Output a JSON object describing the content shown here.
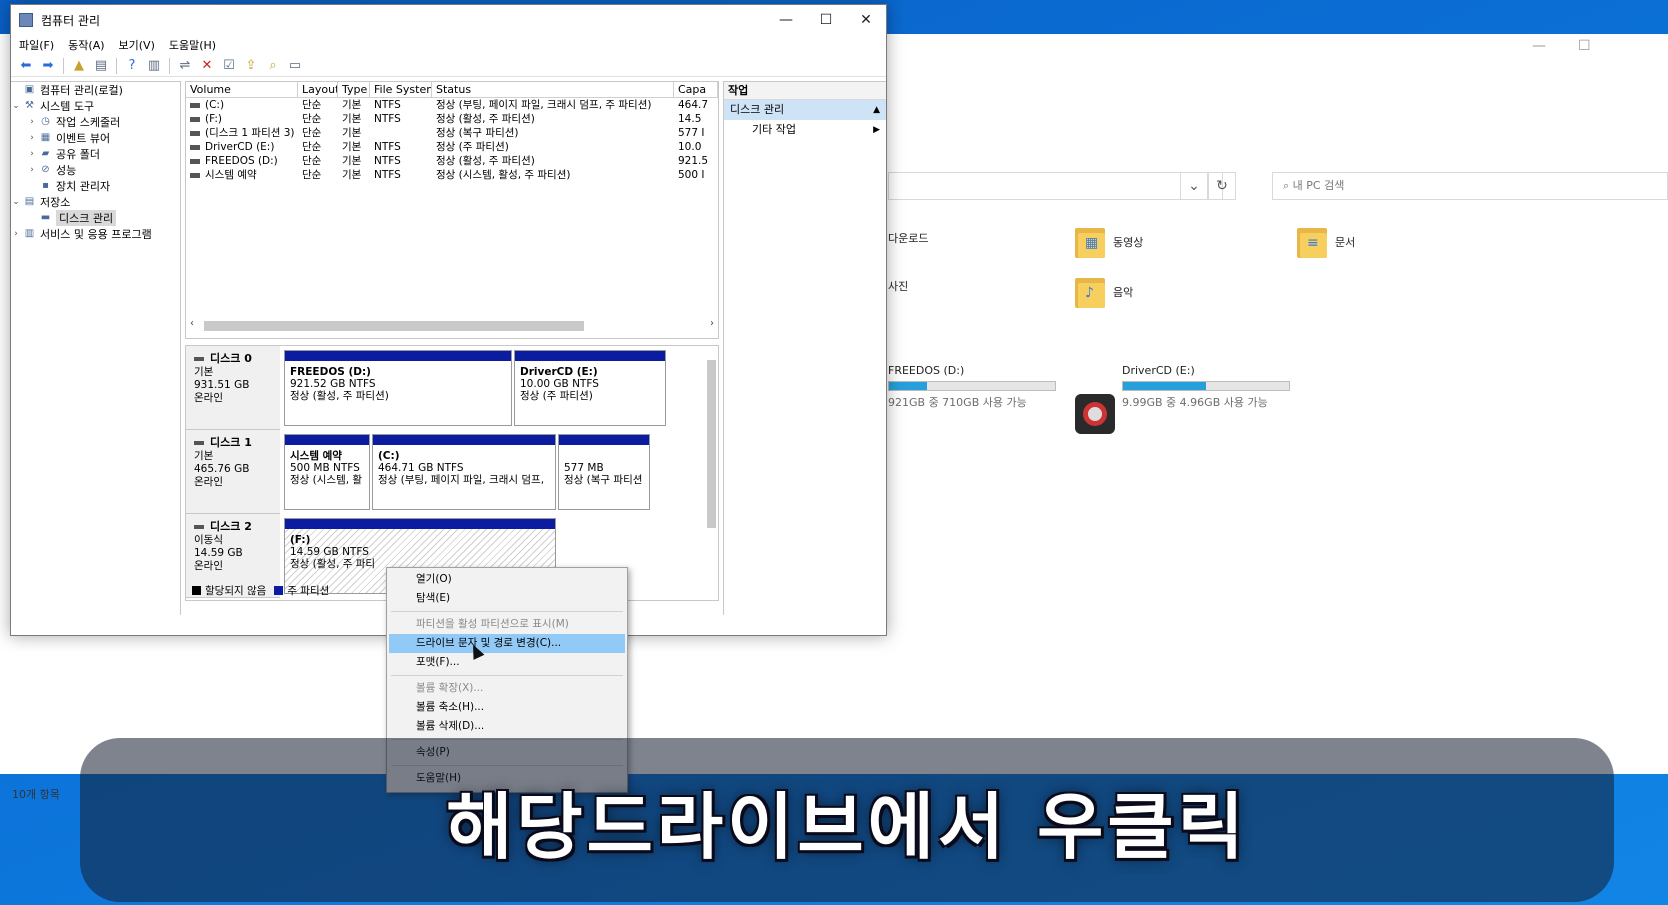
{
  "explorer": {
    "search_placeholder": "내 PC 검색",
    "folders": [
      "다운로드",
      "동영상",
      "문서",
      "사진",
      "음악"
    ],
    "drives": [
      {
        "name": "FREEDOS (D:)",
        "sub": "921GB 중 710GB 사용 가능",
        "used_fraction": 0.23
      },
      {
        "name": "DriverCD (E:)",
        "sub": "9.99GB 중 4.96GB 사용 가능",
        "used_fraction": 0.5
      }
    ],
    "status": "10개 항목"
  },
  "cm": {
    "title": "컴퓨터 관리",
    "menu": [
      "파일(F)",
      "동작(A)",
      "보기(V)",
      "도움말(H)"
    ],
    "tree": {
      "root": "컴퓨터 관리(로컬)",
      "system_tools": "시스템 도구",
      "task_scheduler": "작업 스케줄러",
      "event_viewer": "이벤트 뷰어",
      "shared_folders": "공유 폴더",
      "performance": "성능",
      "device_manager": "장치 관리자",
      "storage": "저장소",
      "disk_management": "디스크 관리",
      "services": "서비스 및 응용 프로그램"
    },
    "list": {
      "headers": [
        "Volume",
        "Layout",
        "Type",
        "File System",
        "Status",
        "Capa"
      ],
      "rows": [
        [
          "(C:)",
          "단순",
          "기본",
          "NTFS",
          "정상 (부팅, 페이지 파일, 크래시 덤프, 주 파티션)",
          "464.7"
        ],
        [
          "(F:)",
          "단순",
          "기본",
          "NTFS",
          "정상 (활성, 주 파티션)",
          "14.5"
        ],
        [
          "(디스크 1 파티션 3)",
          "단순",
          "기본",
          "",
          "정상 (복구 파티션)",
          "577 I"
        ],
        [
          "DriverCD (E:)",
          "단순",
          "기본",
          "NTFS",
          "정상 (주 파티션)",
          "10.0"
        ],
        [
          "FREEDOS (D:)",
          "단순",
          "기본",
          "NTFS",
          "정상 (활성, 주 파티션)",
          "921.5"
        ],
        [
          "시스템 예약",
          "단순",
          "기본",
          "NTFS",
          "정상 (시스템, 활성, 주 파티션)",
          "500 I"
        ]
      ]
    },
    "disks": [
      {
        "name": "디스크 0",
        "type": "기본",
        "size": "931.51 GB",
        "state": "온라인",
        "parts": [
          {
            "title": "FREEDOS  (D:)",
            "size": "921.52 GB NTFS",
            "status": "정상 (활성, 주 파티션)"
          },
          {
            "title": "DriverCD  (E:)",
            "size": "10.00 GB NTFS",
            "status": "정상 (주 파티션)"
          }
        ]
      },
      {
        "name": "디스크 1",
        "type": "기본",
        "size": "465.76 GB",
        "state": "온라인",
        "parts": [
          {
            "title": "시스템 예약",
            "size": "500 MB NTFS",
            "status": "정상 (시스템, 활"
          },
          {
            "title": "(C:)",
            "size": "464.71 GB NTFS",
            "status": "정상 (부팅, 페이지 파일, 크래시 덤프,"
          },
          {
            "title": "",
            "size": "577 MB",
            "status": "정상 (복구 파티션"
          }
        ]
      },
      {
        "name": "디스크 2",
        "type": "이동식",
        "size": "14.59 GB",
        "state": "온라인",
        "parts": [
          {
            "title": "(F:)",
            "size": "14.59 GB NTFS",
            "status": "정상 (활성, 주 파티"
          }
        ]
      }
    ],
    "legend": {
      "unallocated": "할당되지 않음",
      "primary": "주 파티션"
    },
    "actions": {
      "header": "작업",
      "section": "디스크 관리",
      "item": "기타 작업"
    }
  },
  "context_menu": [
    {
      "label": "열기(O)",
      "disabled": false
    },
    {
      "label": "탐색(E)",
      "disabled": false
    },
    {
      "sep": true
    },
    {
      "label": "파티션을 활성 파티션으로 표시(M)",
      "disabled": true
    },
    {
      "label": "드라이브 문자 및 경로 변경(C)...",
      "disabled": false,
      "highlight": true
    },
    {
      "label": "포맷(F)...",
      "disabled": false
    },
    {
      "sep": true
    },
    {
      "label": "볼륨 확장(X)...",
      "disabled": true
    },
    {
      "label": "볼륨 축소(H)...",
      "disabled": false
    },
    {
      "label": "볼륨 삭제(D)...",
      "disabled": false
    },
    {
      "sep": true
    },
    {
      "label": "속성(P)",
      "disabled": false
    },
    {
      "sep": true
    },
    {
      "label": "도움말(H)",
      "disabled": false
    }
  ],
  "caption": "해당드라이브에서 우클릭",
  "colors": {
    "primary_partition": "#0c1ca0",
    "highlight": "#91c9f7",
    "drive_fill": "#26a0da"
  }
}
